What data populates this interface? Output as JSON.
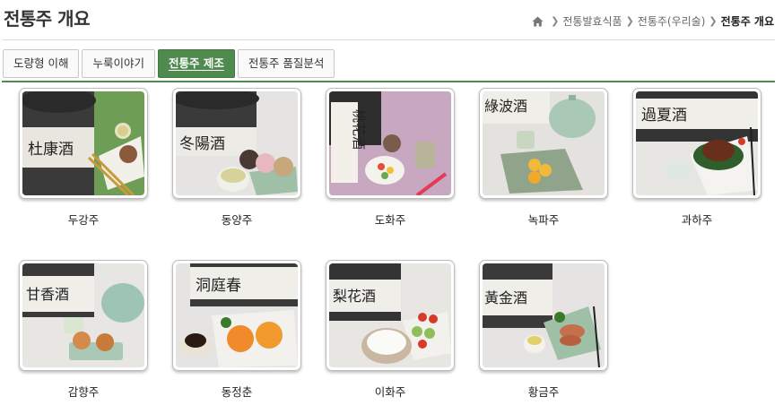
{
  "header": {
    "title": "전통주 개요",
    "breadcrumb": [
      "전통발효식품",
      "전통주(우리술)",
      "전통주 개요"
    ],
    "home_icon": "home-icon"
  },
  "tabs": [
    {
      "label": "도량형 이해",
      "active": false
    },
    {
      "label": "누룩이야기",
      "active": false
    },
    {
      "label": "전통주 제조",
      "active": true
    },
    {
      "label": "전통주 품질분석",
      "active": false
    }
  ],
  "colors": {
    "accent": "#4f8a4f"
  },
  "gallery": [
    {
      "name": "두강주",
      "calligraphy": "杜康酒"
    },
    {
      "name": "동양주",
      "calligraphy": "冬陽酒"
    },
    {
      "name": "도화주",
      "calligraphy": "桃花酒"
    },
    {
      "name": "녹파주",
      "calligraphy": "綠波酒"
    },
    {
      "name": "과하주",
      "calligraphy": "過夏酒"
    },
    {
      "name": "감향주",
      "calligraphy": "甘香酒"
    },
    {
      "name": "동정춘",
      "calligraphy": "洞庭春"
    },
    {
      "name": "이화주",
      "calligraphy": "梨花酒"
    },
    {
      "name": "황금주",
      "calligraphy": "黃金酒"
    }
  ]
}
